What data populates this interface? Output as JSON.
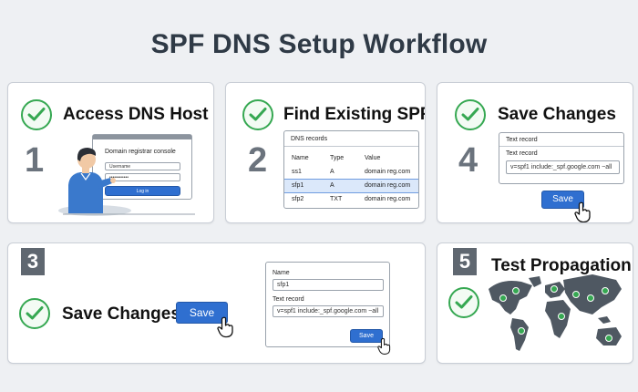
{
  "page": {
    "title": "SPF DNS Setup Workflow"
  },
  "steps": {
    "s1": {
      "number": "1",
      "title": "Access DNS Host",
      "panel_title": "Domain registrar console",
      "username_value": "Username",
      "password_value": "••••••••••••",
      "login_label": "Log in"
    },
    "s2": {
      "number": "2",
      "title": "Find Existing SPF",
      "panel_title": "DNS records",
      "columns": [
        "Name",
        "Type",
        "Value"
      ],
      "rows": [
        [
          "ss1",
          "A",
          "domain reg.com"
        ],
        [
          "sfp1",
          "A",
          "domain reg.com"
        ],
        [
          "sfp2",
          "TXT",
          "domain reg.com"
        ]
      ]
    },
    "s3": {
      "number": "3",
      "title": "Save Changes",
      "save_label": "Save",
      "name_label": "Name",
      "name_value": "sfp1",
      "record_label": "Text record",
      "record_value": "v=spf1 include:_spf.google.com ~all",
      "panel_save_label": "Save"
    },
    "s4": {
      "number": "4",
      "title": "Save Changes",
      "panel_title": "Text record",
      "record_label": "Text record",
      "record_value": "v=spf1 include:_spf.google.com ~all",
      "save_label": "Save"
    },
    "s5": {
      "number": "5",
      "title": "Test Propagation"
    }
  },
  "colors": {
    "check": "#36a852",
    "button": "#2f6fd0",
    "map": "#4f5862"
  }
}
